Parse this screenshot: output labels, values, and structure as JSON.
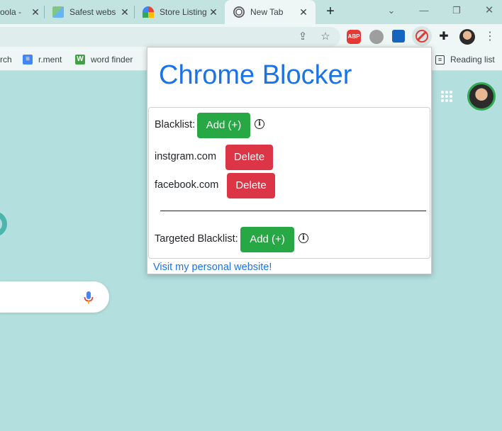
{
  "browser": {
    "tabs": [
      {
        "title": "oola - ",
        "active": false
      },
      {
        "title": "Safest webs",
        "active": false
      },
      {
        "title": "Store Listing",
        "active": false
      },
      {
        "title": "New Tab",
        "active": true
      }
    ],
    "bookmarks": [
      {
        "label": "rch",
        "icon": "none"
      },
      {
        "label": "r.ment",
        "icon": "google-docs-icon"
      },
      {
        "label": "word finder",
        "icon": "word-finder-icon"
      }
    ],
    "reading_list_label": "Reading list",
    "extensions": [
      {
        "name": "adblock-plus-icon",
        "text": "ABP",
        "color": "#e53935"
      },
      {
        "name": "gray-extension-icon",
        "text": "",
        "color": "#9e9e9e"
      },
      {
        "name": "blue-extension-icon",
        "text": "",
        "color": "#1565c0"
      },
      {
        "name": "chrome-blocker-icon",
        "text": "",
        "color": "#e53935"
      }
    ]
  },
  "popup": {
    "title": "Chrome Blocker",
    "blacklist": {
      "label": "Blacklist:",
      "add_label": "Add (+)",
      "items": [
        {
          "site": "instgram.com",
          "delete_label": "Delete"
        },
        {
          "site": "facebook.com",
          "delete_label": "Delete"
        }
      ]
    },
    "targeted_blacklist": {
      "label": "Targeted Blacklist:",
      "add_label": "Add (+)"
    },
    "link_text": "Visit my personal website!"
  },
  "colors": {
    "accent_blue": "#1a73e8",
    "add_green": "#28a745",
    "delete_red": "#dc3545",
    "page_background": "#b3dfde"
  }
}
